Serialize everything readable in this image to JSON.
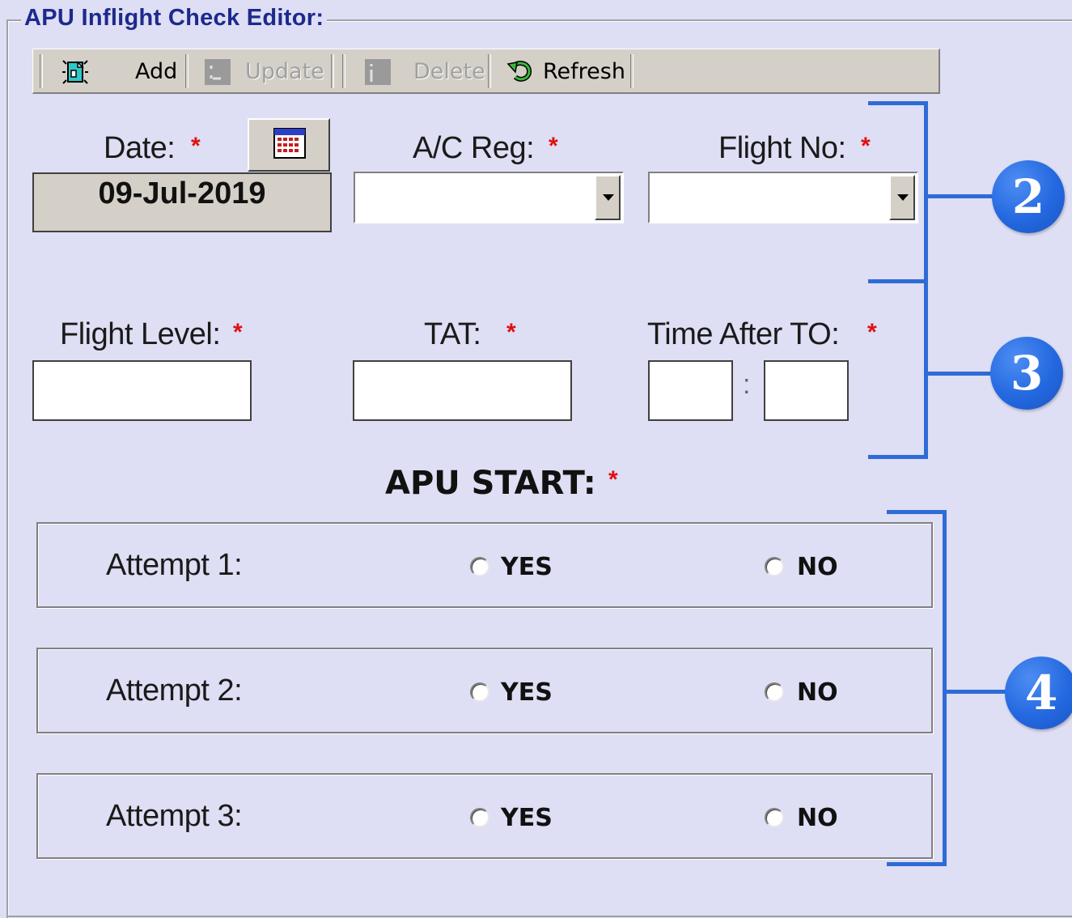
{
  "group_title": "APU Inflight Check Editor:",
  "toolbar": {
    "add_label": "Add",
    "update_label": "Update",
    "delete_label": "Delete",
    "refresh_label": "Refresh"
  },
  "fields": {
    "date_label": "Date:",
    "date_value": "09-Jul-2019",
    "ac_reg_label": "A/C Reg:",
    "flight_no_label": "Flight No:",
    "flight_level_label": "Flight Level:",
    "tat_label": "TAT:",
    "time_after_to_label": "Time After TO:",
    "time_separator": ":",
    "required_mark": "*"
  },
  "apu_start": {
    "title": "APU START:",
    "yes_label": "YES",
    "no_label": "NO",
    "attempts": [
      {
        "label": "Attempt 1:"
      },
      {
        "label": "Attempt 2:"
      },
      {
        "label": "Attempt 3:"
      }
    ]
  },
  "callouts": [
    "2",
    "3",
    "4"
  ],
  "colors": {
    "background": "#dedef4",
    "title": "#1c2a8c",
    "required": "#e01010",
    "callout": "#2f6bd6"
  }
}
